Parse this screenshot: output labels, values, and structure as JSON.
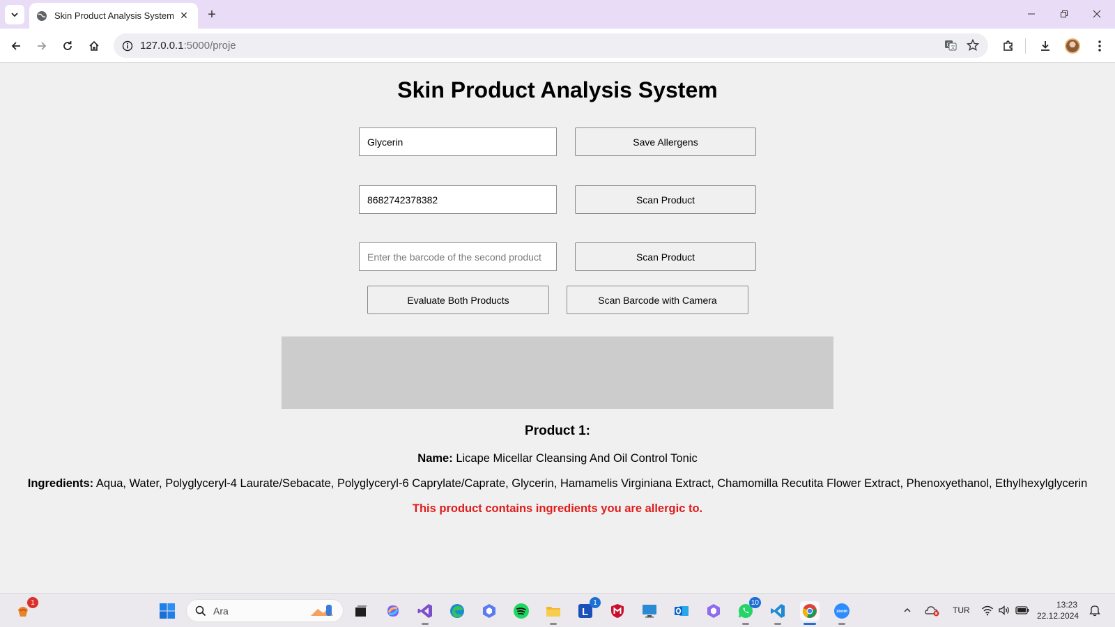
{
  "browser": {
    "tab": {
      "title": "Skin Product Analysis System"
    },
    "address": {
      "host": "127.0.0.1",
      "path": ":5000/proje"
    }
  },
  "page": {
    "title": "Skin Product Analysis System",
    "allergen_input": {
      "value": "Glycerin"
    },
    "save_allergens_label": "Save Allergens",
    "barcode1_input": {
      "value": "8682742378382"
    },
    "scan_product_label_1": "Scan Product",
    "barcode2_input": {
      "value": "",
      "placeholder": "Enter the barcode of the second product"
    },
    "scan_product_label_2": "Scan Product",
    "evaluate_label": "Evaluate Both Products",
    "camera_label": "Scan Barcode with Camera",
    "product1": {
      "heading": "Product 1:",
      "name_label": "Name:",
      "name": "Licape Micellar Cleansing And Oil Control Tonic",
      "ingredients_label": "Ingredients:",
      "ingredients": "Aqua, Water, Polyglyceryl-4 Laurate/Sebacate, Polyglyceryl-6 Caprylate/Caprate, Glycerin, Hamamelis Virginiana Extract, Chamomilla Recutita Flower Extract, Phenoxyethanol, Ethylhexylglycerin",
      "warning": "This product contains ingredients you are allergic to."
    }
  },
  "taskbar": {
    "search_placeholder": "Ara",
    "badges": {
      "tray_app": "1",
      "app_l": "1",
      "whatsapp": "10"
    },
    "language": "TUR",
    "time": "13:23",
    "date": "22.12.2024"
  },
  "colors": {
    "warning": "#e01b1b",
    "titlebar": "#e8dcf6",
    "page_background": "#f0f0f0"
  }
}
